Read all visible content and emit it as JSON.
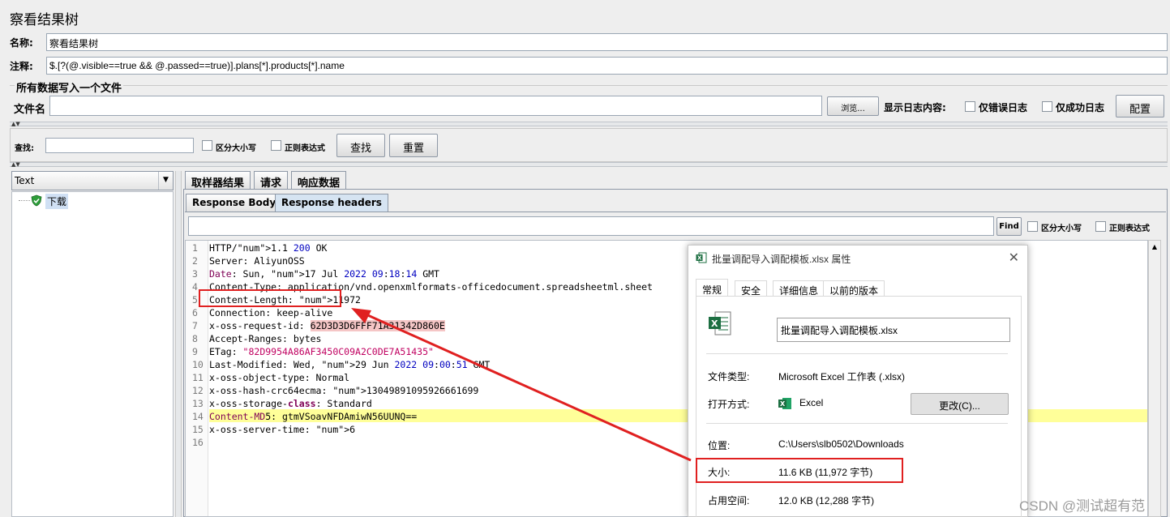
{
  "window": {
    "title": "察看结果树"
  },
  "form": {
    "name_label": "名称:",
    "name_value": "察看结果树",
    "comment_label": "注释:",
    "comment_value": "$.[?(@.visible==true && @.passed==true)].plans[*].products[*].name",
    "group_title": "所有数据写入一个文件",
    "file_label": "文件名",
    "file_value": "",
    "browse_label": "浏览...",
    "log_label": "显示日志内容:",
    "errors_only": "仅错误日志",
    "success_only": "仅成功日志",
    "config_label": "配置"
  },
  "search": {
    "label": "查找:",
    "value": "",
    "case_label": "区分大小写",
    "regex_label": "正则表达式",
    "find_label": "查找",
    "reset_label": "重置"
  },
  "tree": {
    "renderer": "Text",
    "items": [
      {
        "label": "下载",
        "status": "success"
      }
    ]
  },
  "tabs": {
    "main": [
      "取样器结果",
      "请求",
      "响应数据"
    ],
    "active_main": 2,
    "sub": [
      "Response Body",
      "Response headers"
    ],
    "active_sub": 1
  },
  "finder": {
    "value": "",
    "find_label": "Find",
    "case_label": "区分大小写",
    "regex_label": "正则表达式"
  },
  "response_lines": [
    "HTTP/1.1 200 OK",
    "Server: AliyunOSS",
    "Date: Sun, 17 Jul 2022 09:18:14 GMT",
    "Content-Type: application/vnd.openxmlformats-officedocument.spreadsheetml.sheet",
    "Content-Length: 11972",
    "Connection: keep-alive",
    "x-oss-request-id: 62D3D3D6FFF71A31342D860E",
    "Accept-Ranges: bytes",
    "ETag: \"82D9954A86AF3450C09A2C0DE7A51435\"",
    "Last-Modified: Wed, 29 Jun 2022 09:00:51 GMT",
    "x-oss-object-type: Normal",
    "x-oss-hash-crc64ecma: 13049891095926661699",
    "x-oss-storage-class: Standard",
    "Content-MD5: gtmVSoavNFDAmiwN56UUNQ==",
    "x-oss-server-time: 6",
    ""
  ],
  "dialog": {
    "title": "批量调配导入调配模板.xlsx 属性",
    "tabs": [
      "常规",
      "安全",
      "详细信息",
      "以前的版本"
    ],
    "filename": "批量调配导入调配模板.xlsx",
    "type_label": "文件类型:",
    "type_value": "Microsoft Excel 工作表 (.xlsx)",
    "open_label": "打开方式:",
    "open_value": "Excel",
    "change_label": "更改(C)...",
    "location_label": "位置:",
    "location_value": "C:\\Users\\slb0502\\Downloads",
    "size_label": "大小:",
    "size_value": "11.6 KB (11,972 字节)",
    "disk_label": "占用空间:",
    "disk_value": "12.0 KB (12,288 字节)"
  },
  "watermark": "CSDN @测试超有范",
  "colors": {
    "annotation_red": "#e02020",
    "excel_green": "#1d6f42",
    "current_line": "#ffff99"
  }
}
